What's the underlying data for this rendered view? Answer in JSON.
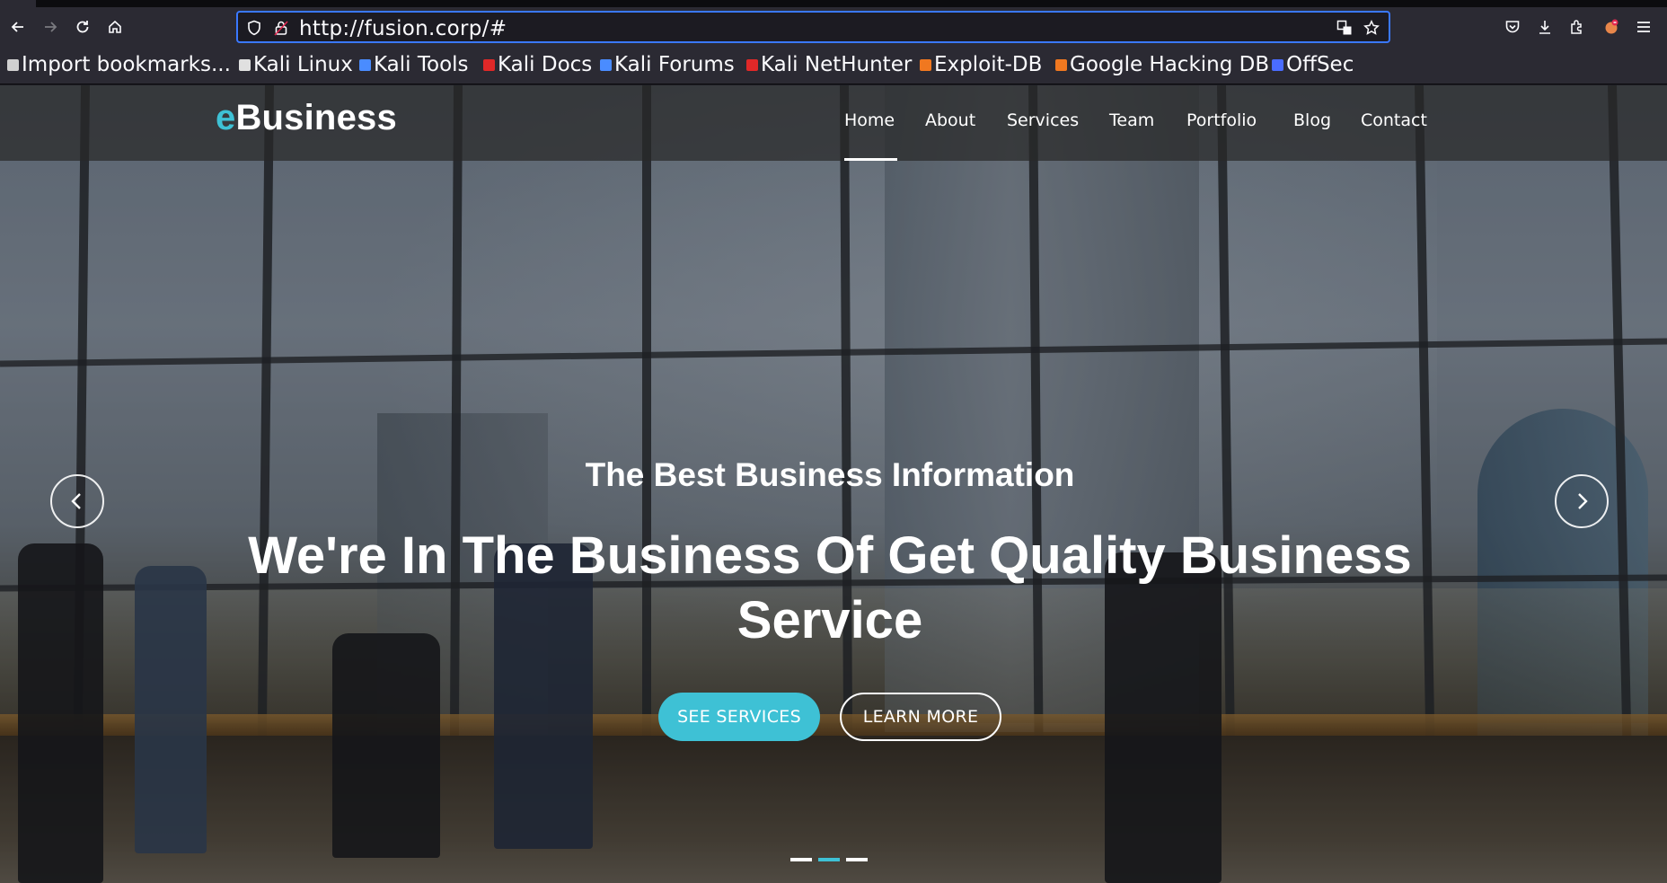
{
  "browser": {
    "url": "http://fusion.corp/#",
    "bookmarks": [
      {
        "label": "Import bookmarks...",
        "color": "#d0d0d0"
      },
      {
        "label": "Kali Linux",
        "color": "#e0e0e0"
      },
      {
        "label": "Kali Tools",
        "color": "#4a8cff"
      },
      {
        "label": "Kali Docs",
        "color": "#e02828"
      },
      {
        "label": "Kali Forums",
        "color": "#4a8cff"
      },
      {
        "label": "Kali NetHunter",
        "color": "#e02828"
      },
      {
        "label": "Exploit-DB",
        "color": "#f07820"
      },
      {
        "label": "Google Hacking DB",
        "color": "#f07820"
      },
      {
        "label": "OffSec",
        "color": "#4a6cff"
      }
    ]
  },
  "site": {
    "logo_prefix": "e",
    "logo_rest": "Business",
    "menu": [
      "Home",
      "About",
      "Services",
      "Team",
      "Portfolio",
      "Blog",
      "Contact"
    ],
    "active_menu": "Home",
    "accent_color": "#3ec1d5"
  },
  "hero": {
    "subtitle": "The Best Business Information",
    "headline": "We're In The Business Of Get Quality Business Service",
    "primary_button": "SEE SERVICES",
    "secondary_button": "LEARN MORE",
    "slide_count": 3,
    "active_slide": 2
  }
}
